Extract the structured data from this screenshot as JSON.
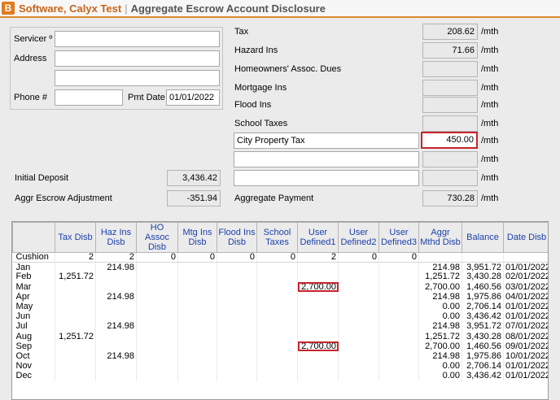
{
  "window": {
    "logo_letter": "B",
    "company": "Software, Calyx Test",
    "separator": "|",
    "page_title": "Aggregate Escrow Account Disclosure"
  },
  "servicer": {
    "servicer_label": "Servicer º",
    "servicer_value": "",
    "address_label": "Address",
    "address_line1": "",
    "address_line2": "",
    "phone_label": "Phone #",
    "phone_value": "",
    "pmt_date_label": "Pmt Date",
    "pmt_date_value": "01/01/2022"
  },
  "escrow_items": [
    {
      "label": "Tax",
      "value": "208.62",
      "unit": "/mth"
    },
    {
      "label": "Hazard Ins",
      "value": "71.66",
      "unit": "/mth"
    },
    {
      "label": "Homeowners' Assoc. Dues",
      "value": "",
      "unit": "/mth"
    },
    {
      "label": "Mortgage Ins",
      "value": "",
      "unit": "/mth"
    },
    {
      "label": "Flood Ins",
      "value": "",
      "unit": "/mth"
    },
    {
      "label": "School Taxes",
      "value": "",
      "unit": "/mth"
    }
  ],
  "user_defined": [
    {
      "name": "City Property Tax",
      "value": "450.00",
      "unit": "/mth"
    },
    {
      "name": "",
      "value": "",
      "unit": "/mth"
    },
    {
      "name": "",
      "value": "",
      "unit": "/mth"
    }
  ],
  "totals": {
    "initial_deposit_label": "Initial Deposit",
    "initial_deposit_value": "3,436.42",
    "aggr_adj_label": "Aggr Escrow Adjustment",
    "aggr_adj_value": "-351.94",
    "aggregate_payment_label": "Aggregate Payment",
    "aggregate_payment_value": "730.28",
    "aggregate_payment_unit": "/mth"
  },
  "table": {
    "headers": [
      "",
      "Tax Disb",
      "Haz Ins Disb",
      "HO Assoc Disb",
      "Mtg Ins Disb",
      "Flood Ins Disb",
      "School Taxes",
      "User Defined1",
      "User Defined2",
      "User Defined3",
      "Aggr Mthd Disb",
      "Balance",
      "Date Disb"
    ],
    "cushion": [
      "Cushion",
      "2",
      "2",
      "0",
      "0",
      "0",
      "0",
      "2",
      "0",
      "0",
      "",
      "",
      ""
    ],
    "rows": [
      [
        "Jan",
        "",
        "214.98",
        "",
        "",
        "",
        "",
        "",
        "",
        "",
        "214.98",
        "3,951.72",
        "01/01/2022"
      ],
      [
        "Feb",
        "1,251.72",
        "",
        "",
        "",
        "",
        "",
        "",
        "",
        "",
        "1,251.72",
        "3,430.28",
        "02/01/2022"
      ],
      [
        "Mar",
        "",
        "",
        "",
        "",
        "",
        "",
        "2,700.00",
        "",
        "",
        "2,700.00",
        "1,460.56",
        "03/01/2022"
      ],
      [
        "Apr",
        "",
        "214.98",
        "",
        "",
        "",
        "",
        "",
        "",
        "",
        "214.98",
        "1,975.86",
        "04/01/2022"
      ],
      [
        "May",
        "",
        "",
        "",
        "",
        "",
        "",
        "",
        "",
        "",
        "0.00",
        "2,706.14",
        "01/01/2022"
      ],
      [
        "Jun",
        "",
        "",
        "",
        "",
        "",
        "",
        "",
        "",
        "",
        "0.00",
        "3,436.42",
        "01/01/2022"
      ],
      [
        "Jul",
        "",
        "214.98",
        "",
        "",
        "",
        "",
        "",
        "",
        "",
        "214.98",
        "3,951.72",
        "07/01/2022"
      ],
      [
        "Aug",
        "1,251.72",
        "",
        "",
        "",
        "",
        "",
        "",
        "",
        "",
        "1,251.72",
        "3,430.28",
        "08/01/2022"
      ],
      [
        "Sep",
        "",
        "",
        "",
        "",
        "",
        "",
        "2,700.00",
        "",
        "",
        "2,700.00",
        "1,460.56",
        "09/01/2022"
      ],
      [
        "Oct",
        "",
        "214.98",
        "",
        "",
        "",
        "",
        "",
        "",
        "",
        "214.98",
        "1,975.86",
        "10/01/2022"
      ],
      [
        "Nov",
        "",
        "",
        "",
        "",
        "",
        "",
        "",
        "",
        "",
        "0.00",
        "2,706.14",
        "01/01/2022"
      ],
      [
        "Dec",
        "",
        "",
        "",
        "",
        "",
        "",
        "",
        "",
        "",
        "0.00",
        "3,436.42",
        "01/01/2022"
      ]
    ],
    "highlighted_rows": [
      2,
      8
    ],
    "highlighted_col": 7
  },
  "colors": {
    "accent": "#c8641a",
    "header_text": "#1c3fa8",
    "highlight": "#c8232b"
  }
}
